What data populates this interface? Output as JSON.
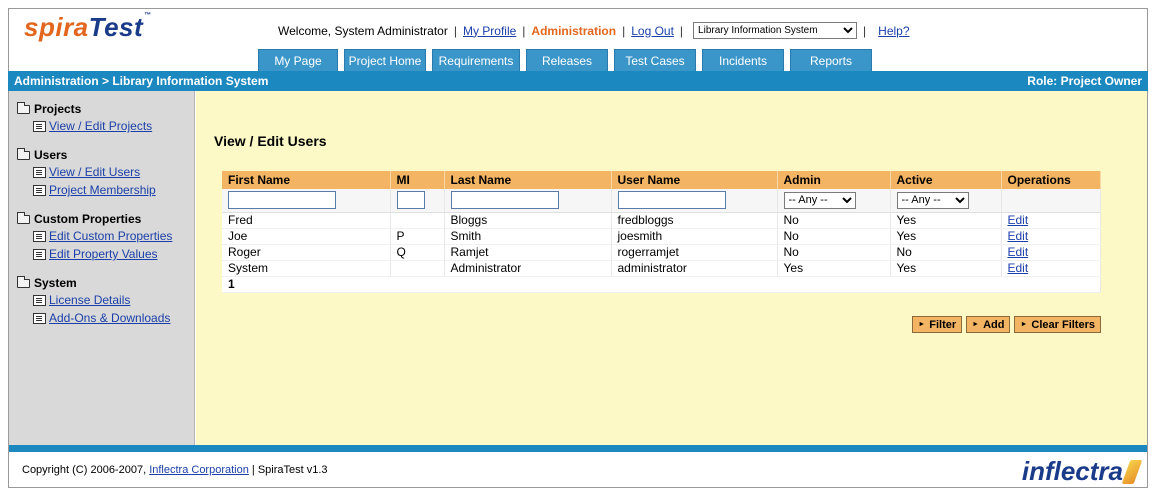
{
  "logo": {
    "spira": "spira",
    "test": "Test",
    "tm": "™"
  },
  "header": {
    "welcome": "Welcome, System Administrator",
    "my_profile": "My Profile",
    "administration": "Administration",
    "logout": "Log Out",
    "project_select": "Library Information System",
    "help": "Help?"
  },
  "tabs": [
    "My Page",
    "Project Home",
    "Requirements",
    "Releases",
    "Test Cases",
    "Incidents",
    "Reports"
  ],
  "bar": {
    "breadcrumb": "Administration > Library Information System",
    "role": "Role: Project Owner"
  },
  "sidebar": {
    "projects": {
      "title": "Projects",
      "items": [
        "View / Edit Projects"
      ]
    },
    "users": {
      "title": "Users",
      "items": [
        "View / Edit Users",
        "Project Membership"
      ]
    },
    "custom": {
      "title": "Custom Properties",
      "items": [
        "Edit Custom Properties",
        "Edit Property Values"
      ]
    },
    "system": {
      "title": "System",
      "items": [
        "License Details",
        "Add-Ons & Downloads"
      ]
    }
  },
  "main": {
    "title": "View / Edit Users",
    "columns": [
      "First Name",
      "MI",
      "Last Name",
      "User Name",
      "Admin",
      "Active",
      "Operations"
    ],
    "filter_any": "-- Any --",
    "rows": [
      {
        "first": "Fred",
        "mi": "",
        "last": "Bloggs",
        "user": "fredbloggs",
        "admin": "No",
        "active": "Yes",
        "op": "Edit"
      },
      {
        "first": "Joe",
        "mi": "P",
        "last": "Smith",
        "user": "joesmith",
        "admin": "No",
        "active": "Yes",
        "op": "Edit"
      },
      {
        "first": "Roger",
        "mi": "Q",
        "last": "Ramjet",
        "user": "rogerramjet",
        "admin": "No",
        "active": "No",
        "op": "Edit"
      },
      {
        "first": "System",
        "mi": "",
        "last": "Administrator",
        "user": "administrator",
        "admin": "Yes",
        "active": "Yes",
        "op": "Edit"
      }
    ],
    "page": "1",
    "buttons": {
      "filter": "Filter",
      "add": "Add",
      "clear": "Clear Filters"
    }
  },
  "footer": {
    "copyright": "Copyright (C) 2006-2007,",
    "company": "Inflectra Corporation",
    "version": "| SpiraTest v1.3",
    "logo": "inflectra"
  }
}
